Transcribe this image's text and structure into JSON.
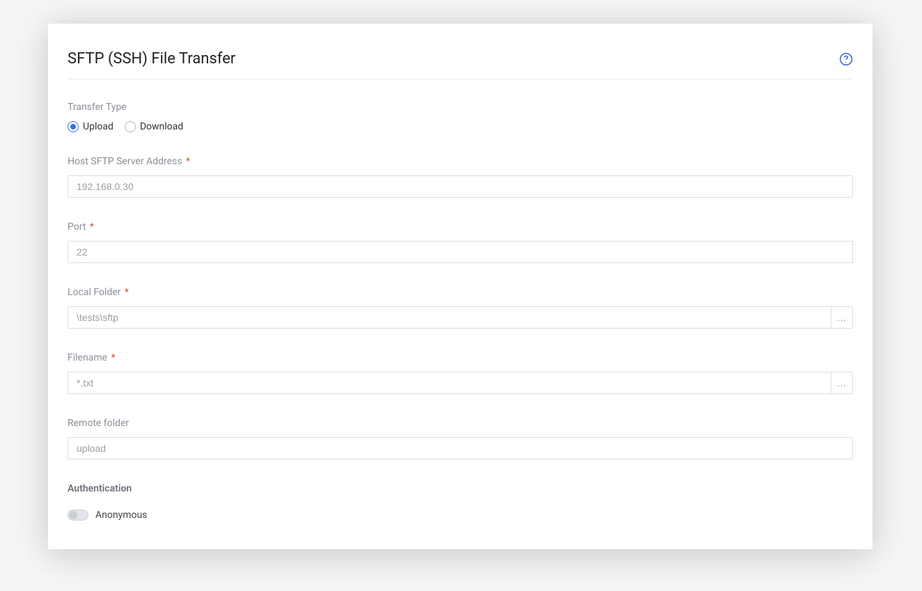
{
  "title": "SFTP (SSH) File Transfer",
  "transferType": {
    "label": "Transfer Type",
    "options": {
      "upload": "Upload",
      "download": "Download"
    },
    "selected": "upload"
  },
  "fields": {
    "host": {
      "label": "Host SFTP Server Address",
      "required": true,
      "value": "192.168.0.30"
    },
    "port": {
      "label": "Port",
      "required": true,
      "value": "22"
    },
    "localFolder": {
      "label": "Local Folder",
      "required": true,
      "value": "\\tests\\sftp",
      "browse": "..."
    },
    "filename": {
      "label": "Filename",
      "required": true,
      "value": "*.txt",
      "browse": "..."
    },
    "remoteFolder": {
      "label": "Remote folder",
      "required": false,
      "value": "upload"
    }
  },
  "authentication": {
    "heading": "Authentication",
    "anonymous": {
      "label": "Anonymous",
      "enabled": false
    }
  },
  "requiredMark": "*"
}
